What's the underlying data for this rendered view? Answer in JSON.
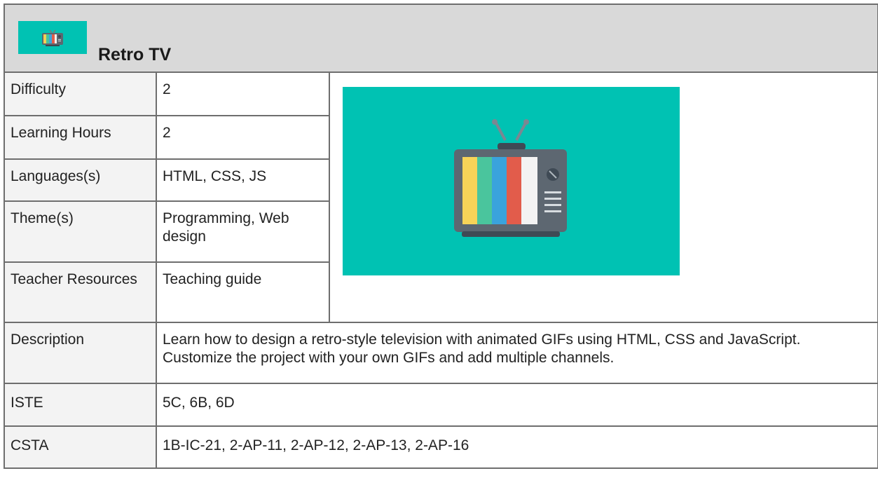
{
  "project": {
    "title": "Retro TV",
    "thumbnail_icon": "retro-tv-icon",
    "hero_icon": "retro-tv-icon",
    "accent_color": "#00c2b3"
  },
  "rows": [
    {
      "label": "Difficulty",
      "value": "2"
    },
    {
      "label": "Learning Hours",
      "value": "2"
    },
    {
      "label": "Languages(s)",
      "value": "HTML, CSS, JS"
    },
    {
      "label": "Theme(s)",
      "value": "Programming, Web design"
    },
    {
      "label": "Teacher Resources",
      "value": "Teaching guide"
    },
    {
      "label": "Description",
      "value": "Learn how to design a retro-style television with animated GIFs using HTML, CSS and JavaScript. Customize the project with your own GIFs and add multiple channels."
    },
    {
      "label": "ISTE",
      "value": "5C, 6B, 6D"
    },
    {
      "label": "CSTA",
      "value": "1B-IC-21, 2-AP-11, 2-AP-12, 2-AP-13,  2-AP-16"
    }
  ]
}
